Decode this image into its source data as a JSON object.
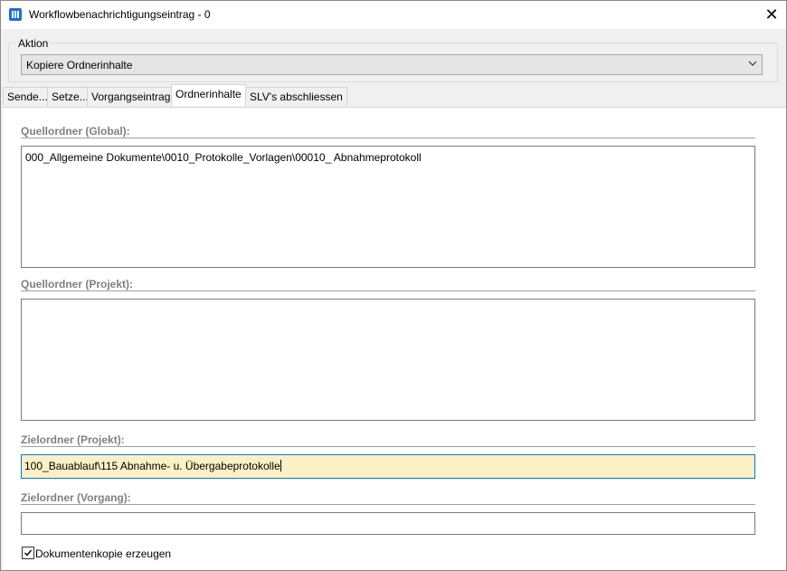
{
  "window": {
    "title": "Workflowbenachrichtigungseintrag - 0",
    "close_glyph": "✕"
  },
  "action": {
    "group_label": "Aktion",
    "selected": "Kopiere Ordnerinhalte",
    "arrow_glyph": "⌄"
  },
  "tabs": [
    {
      "label": "Sende..."
    },
    {
      "label": "Setze..."
    },
    {
      "label": "Vorgangseintrag"
    },
    {
      "label": "Ordnerinhalte"
    },
    {
      "label": "SLV's abschliessen"
    }
  ],
  "active_tab": "Ordnerinhalte",
  "fields": {
    "source_global": {
      "label": "Quellordner (Global):",
      "value": "000_Allgemeine Dokumente\\0010_Protokolle_Vorlagen\\00010_ Abnahmeprotokoll"
    },
    "source_project": {
      "label": "Quellordner (Projekt):",
      "value": ""
    },
    "target_project": {
      "label": "Zielordner (Projekt):",
      "value": "100_Bauablauf\\115 Abnahme- u. Übergabeprotokolle"
    },
    "target_process": {
      "label": "Zielordner (Vorgang):",
      "value": ""
    }
  },
  "checkbox": {
    "label": "Dokumentenkopie erzeugen",
    "checked": true
  },
  "colors": {
    "accent": "#0078d7",
    "focus_bg": "#fdf0c6",
    "section_label": "#808080"
  }
}
